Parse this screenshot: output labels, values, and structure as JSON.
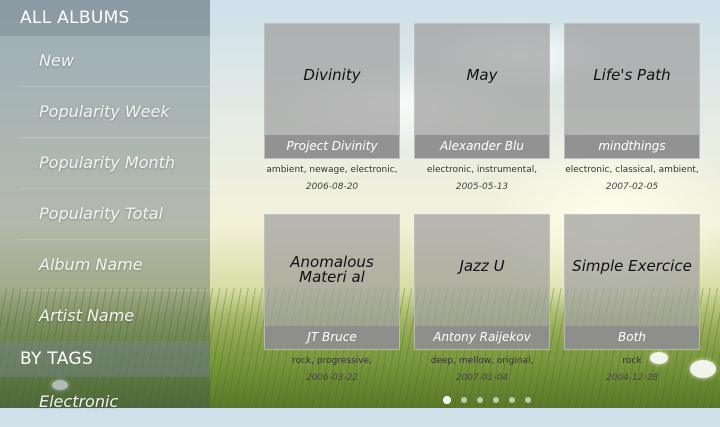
{
  "sidebar": {
    "all_albums_header": "ALL ALBUMS",
    "items": [
      {
        "label": "New"
      },
      {
        "label": "Popularity Week"
      },
      {
        "label": "Popularity Month"
      },
      {
        "label": "Popularity Total"
      },
      {
        "label": "Album Name"
      },
      {
        "label": "Artist Name"
      }
    ],
    "tags_header": "BY TAGS",
    "tag_items": [
      {
        "label": "Electronic"
      }
    ]
  },
  "albums": [
    {
      "title": "Divinity",
      "artist": "Project Divinity",
      "tags": "ambient, newage, electronic,",
      "date": "2006-08-20"
    },
    {
      "title": "May",
      "artist": "Alexander Blu",
      "tags": "electronic, instrumental,",
      "date": "2005-05-13"
    },
    {
      "title": "Life's Path",
      "artist": "mindthings",
      "tags": "electronic, classical, ambient,",
      "date": "2007-02-05"
    },
    {
      "title": "Anomalous Materi al",
      "artist": "JT Bruce",
      "tags": "rock, progressive,",
      "date": "2006-03-22"
    },
    {
      "title": "Jazz U",
      "artist": "Antony Raijekov",
      "tags": "deep, mellow, original,",
      "date": "2007-01-04"
    },
    {
      "title": "Simple Exercice",
      "artist": "Both",
      "tags": "rock",
      "date": "2004-12-28"
    }
  ],
  "pager": {
    "pages": 6,
    "current": 1
  }
}
